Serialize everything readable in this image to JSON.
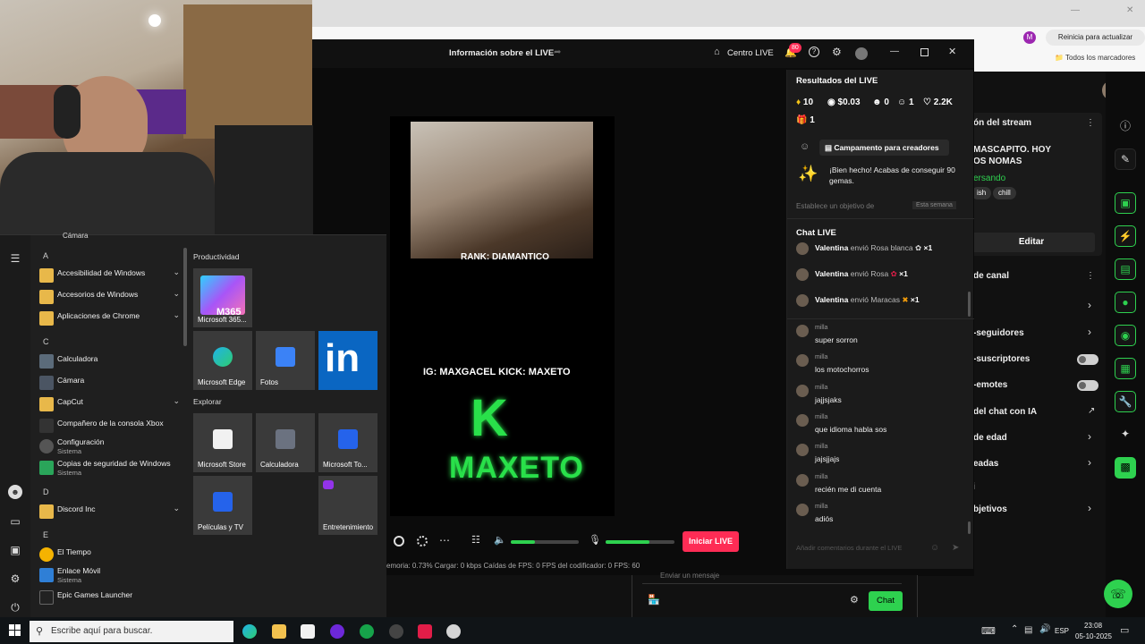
{
  "browser": {
    "update_button": "Reinicia para actualizar",
    "bookmarks": "Todos los marcadores",
    "profile_initial": "M"
  },
  "studio": {
    "header_title": "Información sobre el LIVE",
    "live_center": "Centro LIVE",
    "notif_count": "80",
    "preview": {
      "rank_text": "RANK: DIAMANTICO",
      "social_text": "IG: MAXGACEL KICK: MAXETO",
      "logo_letter": "K",
      "logo_text": "MAXETO"
    },
    "go_live": "Iniciar LIVE",
    "stats": "emoria: 0.73%     Cargar: 0 kbps     Caídas de FPS: 0     FPS del codificador: 0     FPS: 60"
  },
  "results": {
    "title": "Resultados del LIVE",
    "diamonds": "10",
    "money": "$0.03",
    "viewers": "0",
    "followers": "1",
    "likes": "2.2K",
    "gifts": "1",
    "campaign": "Campamento para creadores",
    "achievement": "¡Bien hecho! Acabas de conseguir 90 gemas.",
    "objective": "Establece un objetivo de",
    "week": "Esta semana"
  },
  "chat": {
    "title": "Chat LIVE",
    "gifts": [
      {
        "user": "Valentina",
        "action": "envió Rosa blanca",
        "count": "×1"
      },
      {
        "user": "Valentina",
        "action": "envió Rosa",
        "count": "×1"
      },
      {
        "user": "Valentina",
        "action": "envió Maracas",
        "count": "×1"
      }
    ],
    "messages": [
      {
        "user": "milla",
        "text": "super sorron"
      },
      {
        "user": "milla",
        "text": "los motochorros"
      },
      {
        "user": "milla",
        "text": "jajjsjaks"
      },
      {
        "user": "milla",
        "text": "que idioma habla sos"
      },
      {
        "user": "milla",
        "text": "jajsjjajs"
      },
      {
        "user": "milla",
        "text": "recién me di cuenta"
      },
      {
        "user": "milla",
        "text": "adiós"
      }
    ],
    "input_placeholder": "Añadir comentarios durante el LIVE",
    "send_message": "Enviar un mensaje",
    "chat_button": "Chat"
  },
  "right_panel": {
    "section1": "ón del stream",
    "title_line1": "MASCAPITO. HOY",
    "title_line2": "OS NOMAS",
    "category": "ersando",
    "tags": [
      "ish",
      "chill"
    ],
    "edit": "Editar",
    "section2": "de canal",
    "rows": [
      "-seguidores",
      "-suscriptores",
      "-emotes",
      "del chat con IA",
      "de edad",
      "eadas",
      "i",
      "bjetivos"
    ]
  },
  "camera_label": "Cámara",
  "start_menu": {
    "letters": [
      "A",
      "C",
      "D",
      "E"
    ],
    "apps": [
      {
        "name": "Accesibilidad de Windows",
        "sub": ""
      },
      {
        "name": "Accesorios de Windows",
        "sub": ""
      },
      {
        "name": "Aplicaciones de Chrome",
        "sub": ""
      },
      {
        "name": "Calculadora",
        "sub": ""
      },
      {
        "name": "Cámara",
        "sub": ""
      },
      {
        "name": "CapCut",
        "sub": ""
      },
      {
        "name": "Compañero de la consola Xbox",
        "sub": ""
      },
      {
        "name": "Configuración",
        "sub": "Sistema"
      },
      {
        "name": "Copias de seguridad de Windows",
        "sub": "Sistema"
      },
      {
        "name": "Discord Inc",
        "sub": ""
      },
      {
        "name": "El Tiempo",
        "sub": ""
      },
      {
        "name": "Enlace Móvil",
        "sub": "Sistema"
      },
      {
        "name": "Epic Games Launcher",
        "sub": ""
      }
    ],
    "groups": [
      "Productividad",
      "Explorar"
    ],
    "tiles": [
      "Microsoft 365...",
      "Microsoft Edge",
      "Fotos",
      "Microsoft Store",
      "Calculadora",
      "Microsoft To...",
      "Películas y TV",
      "Entretenimiento"
    ],
    "m365_label": "M365",
    "linkedin_label": "in"
  },
  "taskbar": {
    "search_placeholder": "Escribe aquí para buscar.",
    "lang": "ESP",
    "time": "23:08",
    "date": "05-10-2025"
  }
}
